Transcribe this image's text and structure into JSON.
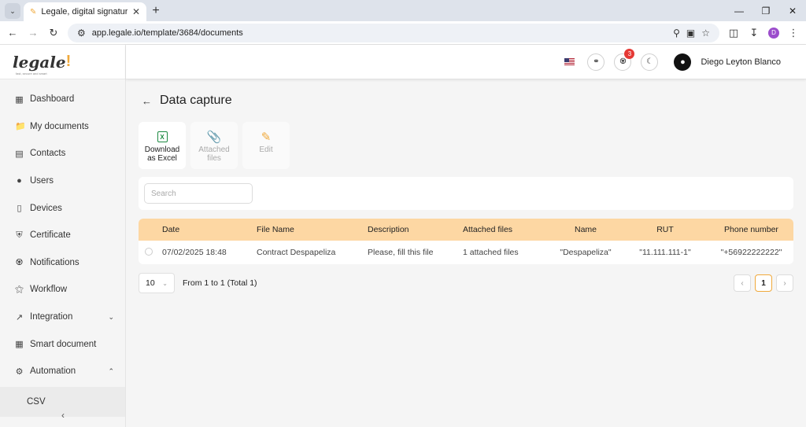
{
  "browser": {
    "tab_title": "Legale, digital signature",
    "url": "app.legale.io/template/3684/documents",
    "profile_initial": "D"
  },
  "sidebar": {
    "logo": "legale",
    "tagline": "fast, secure and smart",
    "items": [
      {
        "label": "Dashboard",
        "icon": "dashboard-icon"
      },
      {
        "label": "My documents",
        "icon": "folder-icon"
      },
      {
        "label": "Contacts",
        "icon": "contacts-icon"
      },
      {
        "label": "Users",
        "icon": "user-icon"
      },
      {
        "label": "Devices",
        "icon": "device-icon"
      },
      {
        "label": "Certificate",
        "icon": "shield-icon"
      },
      {
        "label": "Notifications",
        "icon": "bell-icon"
      },
      {
        "label": "Workflow",
        "icon": "workflow-icon"
      },
      {
        "label": "Integration",
        "icon": "external-link-icon"
      },
      {
        "label": "Smart document",
        "icon": "layout-icon"
      },
      {
        "label": "Automation",
        "icon": "gear-icon"
      }
    ],
    "sub_item": "CSV"
  },
  "header": {
    "notifications_count": "3",
    "user_name": "Diego Leyton Blanco"
  },
  "page": {
    "title": "Data capture",
    "actions": {
      "download_line1": "Download",
      "download_line2": "as Excel",
      "attached_line1": "Attached",
      "attached_line2": "files",
      "edit": "Edit"
    },
    "search_placeholder": "Search"
  },
  "table": {
    "columns": [
      "Date",
      "File Name",
      "Description",
      "Attached files",
      "Name",
      "RUT",
      "Phone number"
    ],
    "rows": [
      [
        "07/02/2025 18:48",
        "Contract Despapeliza",
        "Please, fill this file",
        "1 attached files",
        "\"Despapeliza\"",
        "\"11.111.111-1\"",
        "\"+56922222222\""
      ]
    ]
  },
  "pagination": {
    "page_size": "10",
    "range": "From 1 to 1 (Total 1)",
    "current_page": "1"
  }
}
